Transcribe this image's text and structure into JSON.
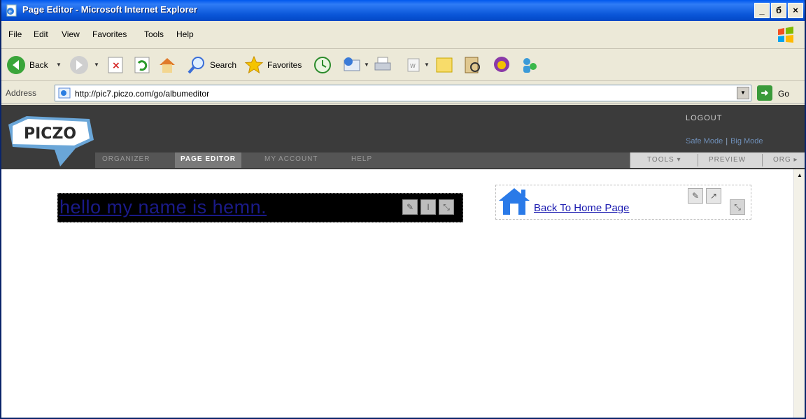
{
  "window": {
    "title": "Page Editor - Microsoft Internet Explorer",
    "minimize": "_",
    "maximize": "б",
    "close": "×"
  },
  "menu": [
    "File",
    "Edit",
    "View",
    "Favorites",
    "Tools",
    "Help"
  ],
  "toolbar": {
    "back": "Back",
    "search": "Search",
    "favorites": "Favorites"
  },
  "address": {
    "label": "Address",
    "url": "http://pic7.piczo.com/go/albumeditor",
    "go": "Go"
  },
  "piczo": {
    "logo": "PICZO",
    "logout": "LOGOUT",
    "safe_mode": "Safe Mode",
    "big_mode": "Big Mode",
    "nav": [
      "ORGANIZER",
      "PAGE EDITOR",
      "MY ACCOUNT",
      "HELP"
    ],
    "active_nav": "PAGE EDITOR",
    "right_tabs": [
      "TOOLS ▾",
      "PREVIEW",
      "ORG ▸"
    ]
  },
  "content": {
    "hello_text": "hello my name is hemn.",
    "home_link": "Back To Home Page"
  },
  "colors": {
    "titlebar": "#0058ee",
    "piczo_bg": "#3b3b3b",
    "link": "#1a1ab0"
  }
}
